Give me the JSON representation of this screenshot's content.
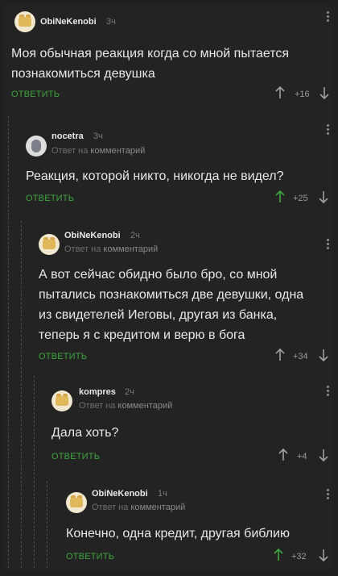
{
  "comments": [
    {
      "author": "ObiNeKenobi",
      "time": "3ч",
      "reply_prefix": "",
      "reply_target": "",
      "text": "Моя обычная реакция когда со мной пытается познакомиться девушка",
      "reply_label": "ОТВЕТИТЬ",
      "score": "+16"
    },
    {
      "author": "nocetra",
      "time": "3ч",
      "reply_prefix": "Ответ на",
      "reply_target": "комментарий",
      "text": "Реакция, которой никто, никогда не видел?",
      "reply_label": "ОТВЕТИТЬ",
      "score": "+25"
    },
    {
      "author": "ObiNeKenobi",
      "time": "2ч",
      "reply_prefix": "Ответ на",
      "reply_target": "комментарий",
      "text": "А вот сейчас обидно было бро, со мной пытались познакомиться две девушки, одна из свидетелей Иеговы, другая из банка, теперь я с кредитом и верю в бога",
      "reply_label": "ОТВЕТИТЬ",
      "score": "+34"
    },
    {
      "author": "kompres",
      "time": "2ч",
      "reply_prefix": "Ответ на",
      "reply_target": "комментарий",
      "text": "Дала хоть?",
      "reply_label": "ОТВЕТИТЬ",
      "score": "+4"
    },
    {
      "author": "ObiNeKenobi",
      "time": "1ч",
      "reply_prefix": "Ответ на",
      "reply_target": "комментарий",
      "text": "Конечно, одна кредит, другая библию",
      "reply_label": "ОТВЕТИТЬ",
      "score": "+32"
    }
  ],
  "colors": {
    "background": "#202020",
    "reply_green": "#3fa63f",
    "muted": "#7a7a7a"
  },
  "icons": [
    "avatar",
    "upvote-arrow-icon",
    "downvote-arrow-icon",
    "more-dots-icon"
  ]
}
